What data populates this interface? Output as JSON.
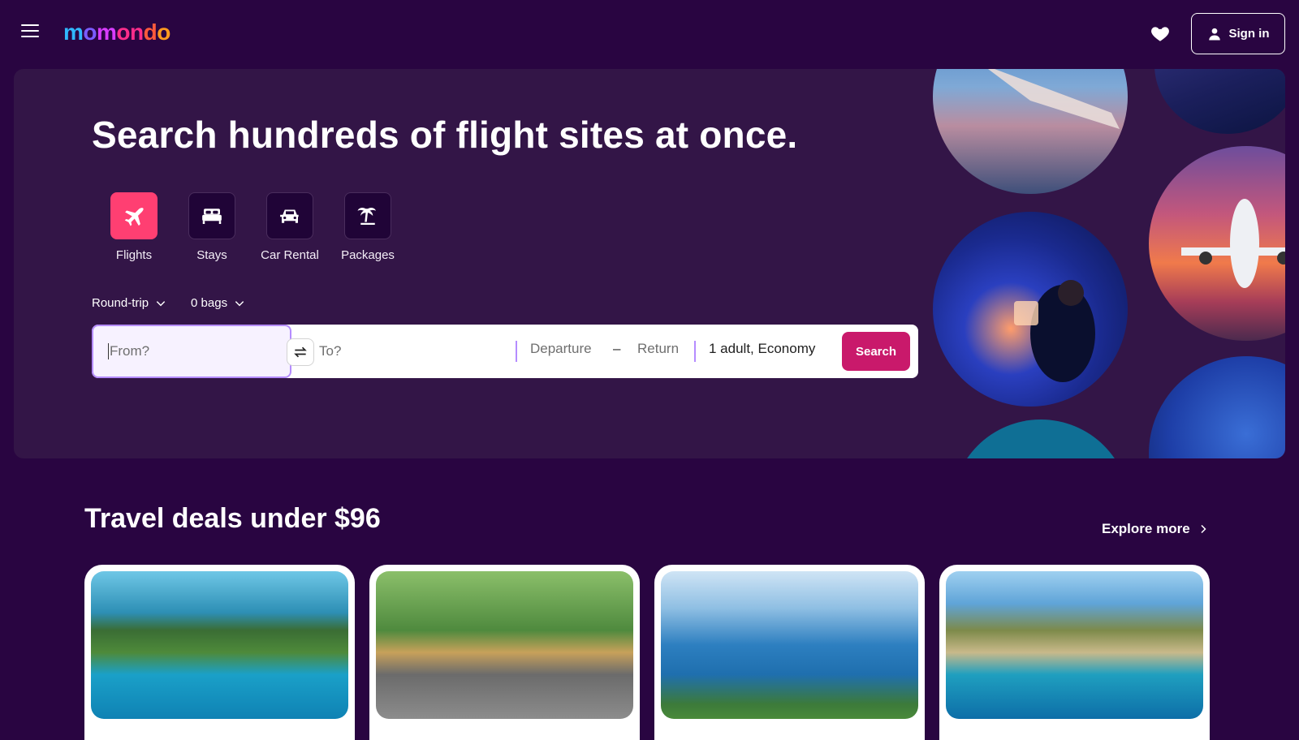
{
  "header": {
    "logo_text": "momondo",
    "signin_label": "Sign in"
  },
  "hero": {
    "title": "Search hundreds of flight sites at once.",
    "tabs": [
      {
        "label": "Flights",
        "icon": "plane-icon",
        "active": true
      },
      {
        "label": "Stays",
        "icon": "bed-icon",
        "active": false
      },
      {
        "label": "Car Rental",
        "icon": "car-icon",
        "active": false
      },
      {
        "label": "Packages",
        "icon": "palm-tree-icon",
        "active": false
      }
    ],
    "trip_type": "Round-trip",
    "bags": "0 bags",
    "search": {
      "from_placeholder": "From?",
      "to_placeholder": "To?",
      "departure_placeholder": "Departure",
      "dash": "–",
      "return_placeholder": "Return",
      "travelers": "1 adult, Economy",
      "search_label": "Search"
    }
  },
  "deals": {
    "title": "Travel deals under $96",
    "explore_label": "Explore more",
    "cards": [
      {
        "image": "tropical-bay-with-boats"
      },
      {
        "image": "lantern-street-cyclist"
      },
      {
        "image": "cable-car-over-sea"
      },
      {
        "image": "coastal-lagoon-aerial"
      }
    ]
  },
  "colors": {
    "background": "#290541",
    "hero_bg": "#331547",
    "active_tab": "#ff3f72",
    "search_button": "#c9196b",
    "field_focus": "#b58cff"
  }
}
